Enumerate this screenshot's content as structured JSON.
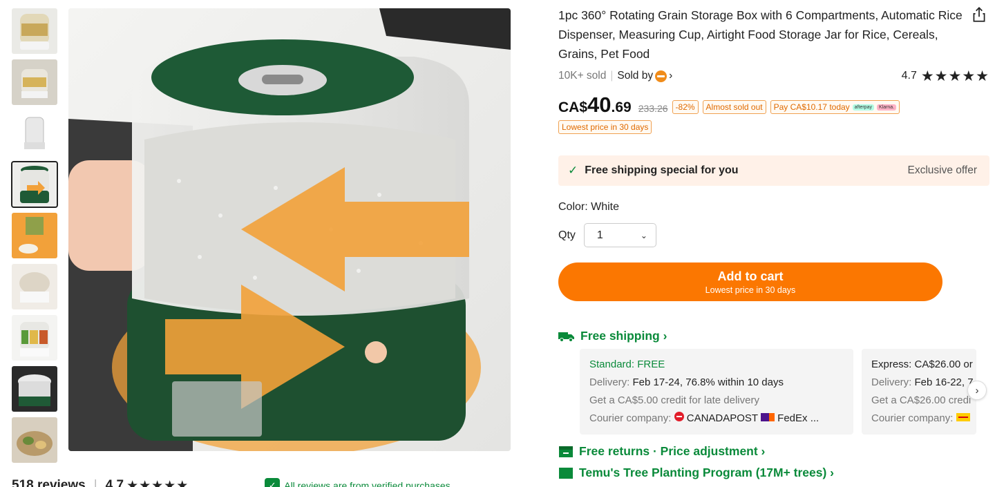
{
  "product": {
    "title": "1pc 360° Rotating Grain Storage Box with 6 Compartments, Automatic Rice Dispenser, Measuring Cup, Airtight Food Storage Jar for Rice, Cereals, Grains, Pet Food",
    "sold": "10K+ sold",
    "sold_by": "Sold by",
    "sold_by_chevron": "›",
    "rating": "4.7",
    "stars": "★★★★★"
  },
  "price": {
    "currency": "CA$",
    "integer": "40",
    "decimal": ".69",
    "original": "233.26",
    "discount": "-82%",
    "stock_tag": "Almost sold out",
    "pay_today": "Pay CA$10.17 today",
    "afterpay": "afterpay",
    "klarna": "Klarna.",
    "lowest_tag": "Lowest price in 30 days"
  },
  "shipping_banner": {
    "check": "✓",
    "label": "Free shipping special for you",
    "exclusive": "Exclusive offer"
  },
  "options": {
    "color_label": "Color: White",
    "qty_label": "Qty",
    "qty_value": "1",
    "qty_chevron": "⌄"
  },
  "cart": {
    "label": "Add to cart",
    "sub": "Lowest price in 30 days"
  },
  "free_shipping": {
    "label": "Free shipping ›",
    "standard": {
      "title": "Standard: FREE",
      "delivery_label": "Delivery: ",
      "delivery_value": "Feb 17-24, 76.8% within 10 days",
      "credit": "Get a CA$5.00 credit for late delivery",
      "courier_label": "Courier company: ",
      "courier_value": "CANADAPOST",
      "courier_value2": "FedEx ..."
    },
    "express": {
      "title": "Express: CA$26.00 or",
      "delivery_label": "Delivery: ",
      "delivery_value": "Feb 16-22, 7",
      "credit": "Get a CA$26.00 credi",
      "courier_label": "Courier company: "
    },
    "next": "›"
  },
  "returns": {
    "label": "Free returns · Price adjustment ›"
  },
  "tree": {
    "label": "Temu's Tree Planting Program (17M+ trees) ›"
  },
  "reviews": {
    "count": "518 reviews",
    "separator": "|",
    "rating": "4.7",
    "stars": "★★★★★",
    "verified": "All reviews are from verified purchases"
  },
  "colors": {
    "accent_orange": "#fb7701",
    "green": "#0a8a3a",
    "banner_bg": "#fff1e8"
  }
}
